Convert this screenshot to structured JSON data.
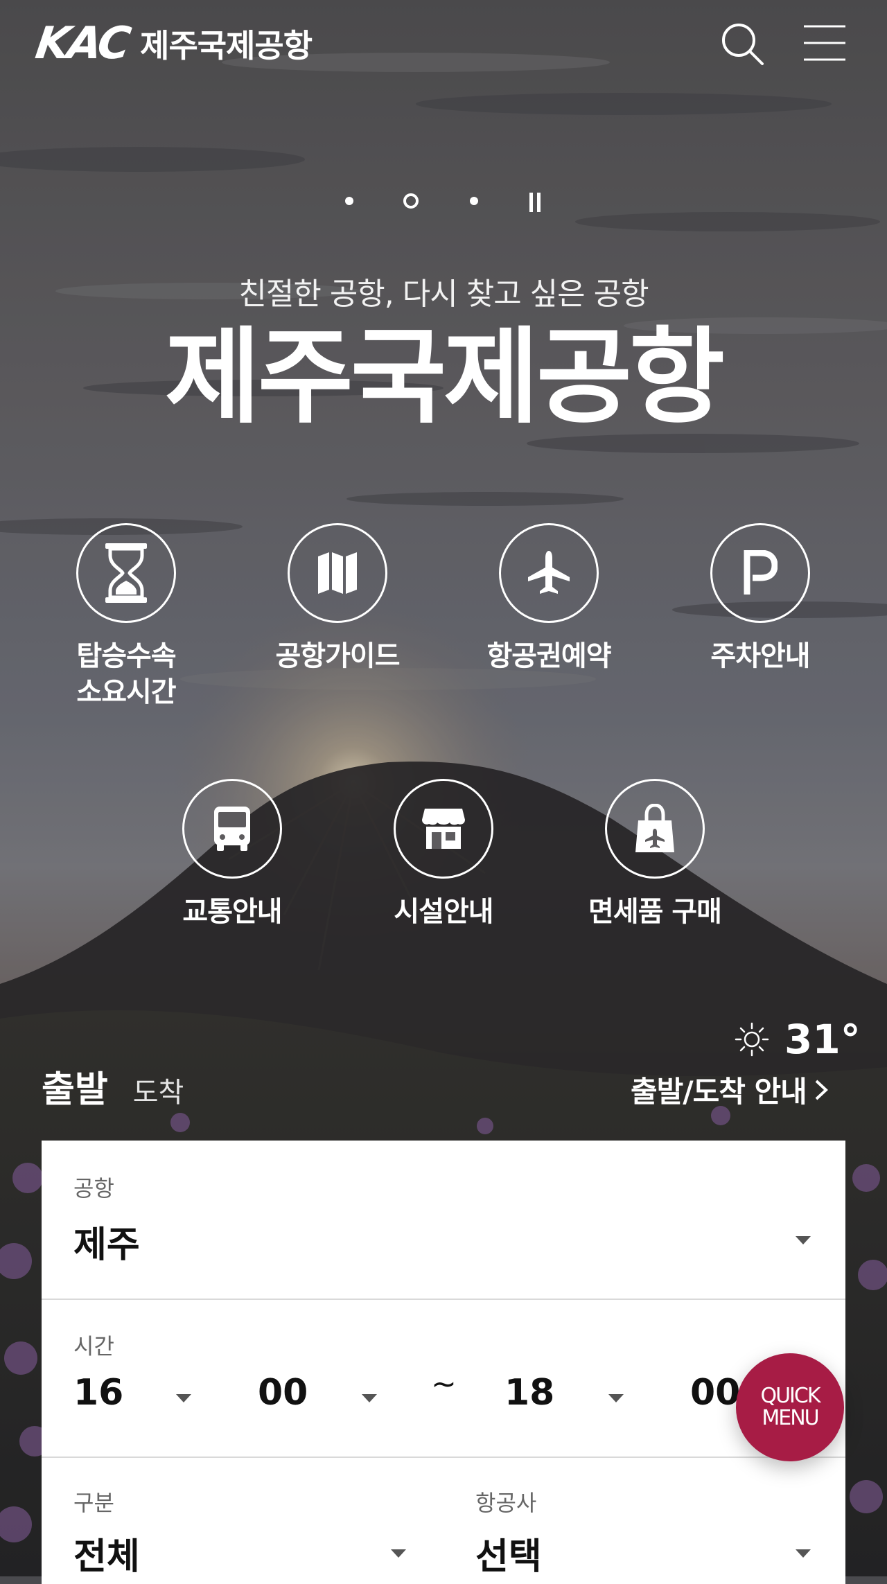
{
  "header": {
    "logo_mark": "KAC",
    "logo_text": "제주국제공항"
  },
  "hero": {
    "subtitle": "친절한 공항, 다시 찾고 싶은 공항",
    "title": "제주국제공항"
  },
  "quick_buttons": [
    {
      "label": "탑승수속\n소요시간",
      "icon": "hourglass-icon"
    },
    {
      "label": "공항가이드",
      "icon": "map-icon"
    },
    {
      "label": "항공권예약",
      "icon": "airplane-icon"
    },
    {
      "label": "주차안내",
      "icon": "parking-icon"
    },
    {
      "label": "교통안내",
      "icon": "bus-icon"
    },
    {
      "label": "시설안내",
      "icon": "store-icon"
    },
    {
      "label": "면세품 구매",
      "icon": "shopping-bag-plane-icon"
    }
  ],
  "weather": {
    "icon": "sun-icon",
    "temperature": "31°"
  },
  "flight": {
    "tab_departure": "출발",
    "tab_arrival": "도착",
    "info_link": "출발/도착 안내"
  },
  "form": {
    "airport_label": "공항",
    "airport_value": "제주",
    "time_label": "시간",
    "time_from_hour": "16",
    "time_from_min": "00",
    "time_sep": "~",
    "time_to_hour": "18",
    "time_to_min": "00",
    "type_label": "구분",
    "type_value": "전체",
    "airline_label": "항공사",
    "airline_value": "선택"
  },
  "quick_menu": {
    "line1": "QUICK",
    "line2": "MENU"
  },
  "colors": {
    "accent": "#a71c45",
    "panel_bg": "#ffffff"
  }
}
